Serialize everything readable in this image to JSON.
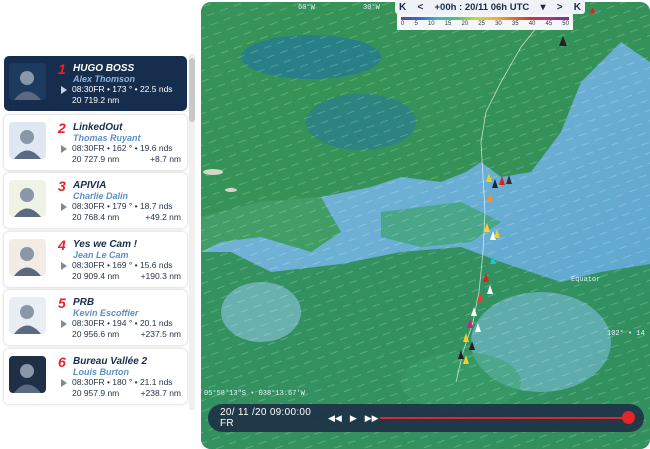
{
  "timebar": {
    "first_label": "K",
    "prev_label": "<",
    "time_label": "+00h : 20/11 06h UTC",
    "dropdown_label": "▾",
    "next_label": ">",
    "last_label": "K"
  },
  "wind_scale": {
    "ticks": [
      "0",
      "5",
      "10",
      "15",
      "20",
      "25",
      "30",
      "35",
      "40",
      "45",
      "50"
    ]
  },
  "map_labels": {
    "top_lon_1": "60°W",
    "top_lon_2": "30°W",
    "equator": "Equator",
    "cursor_coords": "05°58'13\"S • 038°13.67'W",
    "right_coord": "102° • 14"
  },
  "playback": {
    "date": "20/ 11 /20 09:00:00 FR",
    "rewind_label": "◀◀",
    "play_label": "▶",
    "forward_label": "▶▶",
    "progress": 1.0
  },
  "leaderboard": [
    {
      "rank": "1",
      "boat": "HUGO BOSS",
      "skipper": "Alex Thomson",
      "stats": "08:30FR • 173 ° • 22.5 nds",
      "distance": "20 719.2 nm",
      "gap": "",
      "active": true
    },
    {
      "rank": "2",
      "boat": "LinkedOut",
      "skipper": "Thomas Ruyant",
      "stats": "08:30FR • 162 ° • 19.6 nds",
      "distance": "20 727.9 nm",
      "gap": "+8.7 nm",
      "active": false
    },
    {
      "rank": "3",
      "boat": "APIVIA",
      "skipper": "Charlie Dalin",
      "stats": "08:30FR • 179 ° • 18.7 nds",
      "distance": "20 768.4 nm",
      "gap": "+49.2 nm",
      "active": false
    },
    {
      "rank": "4",
      "boat": "Yes we Cam !",
      "skipper": "Jean Le Cam",
      "stats": "08:30FR • 169 ° • 15.6 nds",
      "distance": "20 909.4 nm",
      "gap": "+190.3 nm",
      "active": false
    },
    {
      "rank": "5",
      "boat": "PRB",
      "skipper": "Kevin Escoffier",
      "stats": "08:30FR • 194 ° • 20.1 nds",
      "distance": "20 956.6 nm",
      "gap": "+237.5 nm",
      "active": false
    },
    {
      "rank": "6",
      "boat": "Bureau Vallée 2",
      "skipper": "Louis Burton",
      "stats": "08:30FR • 180 ° • 21.1 nds",
      "distance": "20 957.9 nm",
      "gap": "+238.7 nm",
      "active": false
    }
  ]
}
